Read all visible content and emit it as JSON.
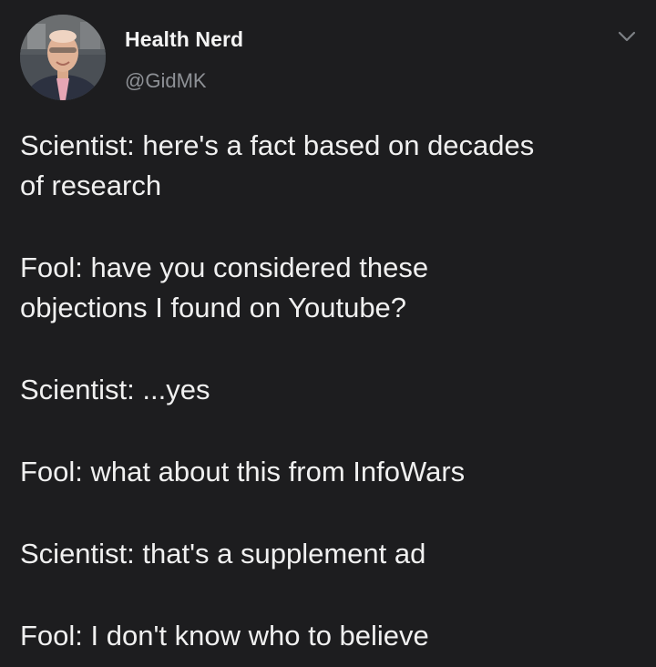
{
  "tweet": {
    "author_name": "Health Nerd",
    "author_handle": "@GidMK",
    "avatar_icon": "profile-photo",
    "menu_icon": "chevron-down-icon",
    "lines": [
      "Scientist: here's a fact based on decades",
      "of research",
      "Fool: have you considered these",
      "objections I found on Youtube?",
      "Scientist: ...yes",
      "Fool: what about this from InfoWars",
      "Scientist: that's a supplement ad",
      "Fool: I don't know who to believe"
    ]
  },
  "colors": {
    "background": "#1d1d1f",
    "text": "#f0f0f0",
    "secondary_text": "#8e9196"
  }
}
